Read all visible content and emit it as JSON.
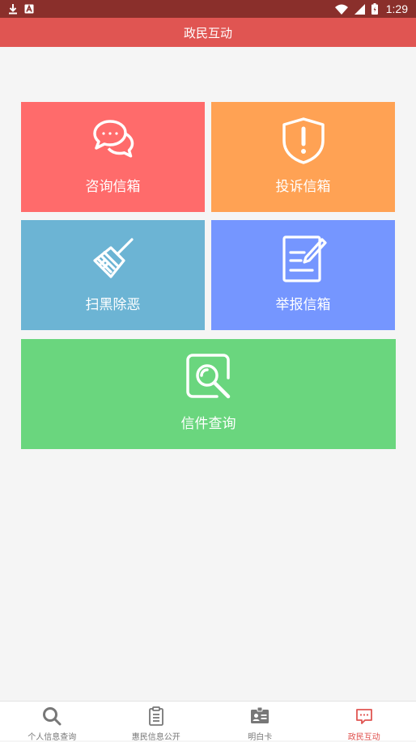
{
  "status_bar": {
    "time": "1:29",
    "icons": [
      "download-icon",
      "app-notification-icon",
      "wifi-icon",
      "signal-icon",
      "battery-icon"
    ]
  },
  "header": {
    "title": "政民互动"
  },
  "tiles": [
    {
      "label": "咨询信箱",
      "icon": "chat-bubbles-icon",
      "color": "#ff6b6b"
    },
    {
      "label": "投诉信箱",
      "icon": "shield-alert-icon",
      "color": "#ffa254"
    },
    {
      "label": "扫黑除恶",
      "icon": "broom-icon",
      "color": "#6cb4d4"
    },
    {
      "label": "举报信箱",
      "icon": "document-edit-icon",
      "color": "#7596ff"
    },
    {
      "label": "信件查询",
      "icon": "search-document-icon",
      "color": "#6ad67e"
    }
  ],
  "bottom_nav": {
    "items": [
      {
        "label": "个人信息查询",
        "icon": "search-icon",
        "active": false
      },
      {
        "label": "惠民信息公开",
        "icon": "clipboard-icon",
        "active": false
      },
      {
        "label": "明白卡",
        "icon": "id-card-icon",
        "active": false
      },
      {
        "label": "政民互动",
        "icon": "message-icon",
        "active": true
      }
    ],
    "active_color": "#e05552"
  }
}
